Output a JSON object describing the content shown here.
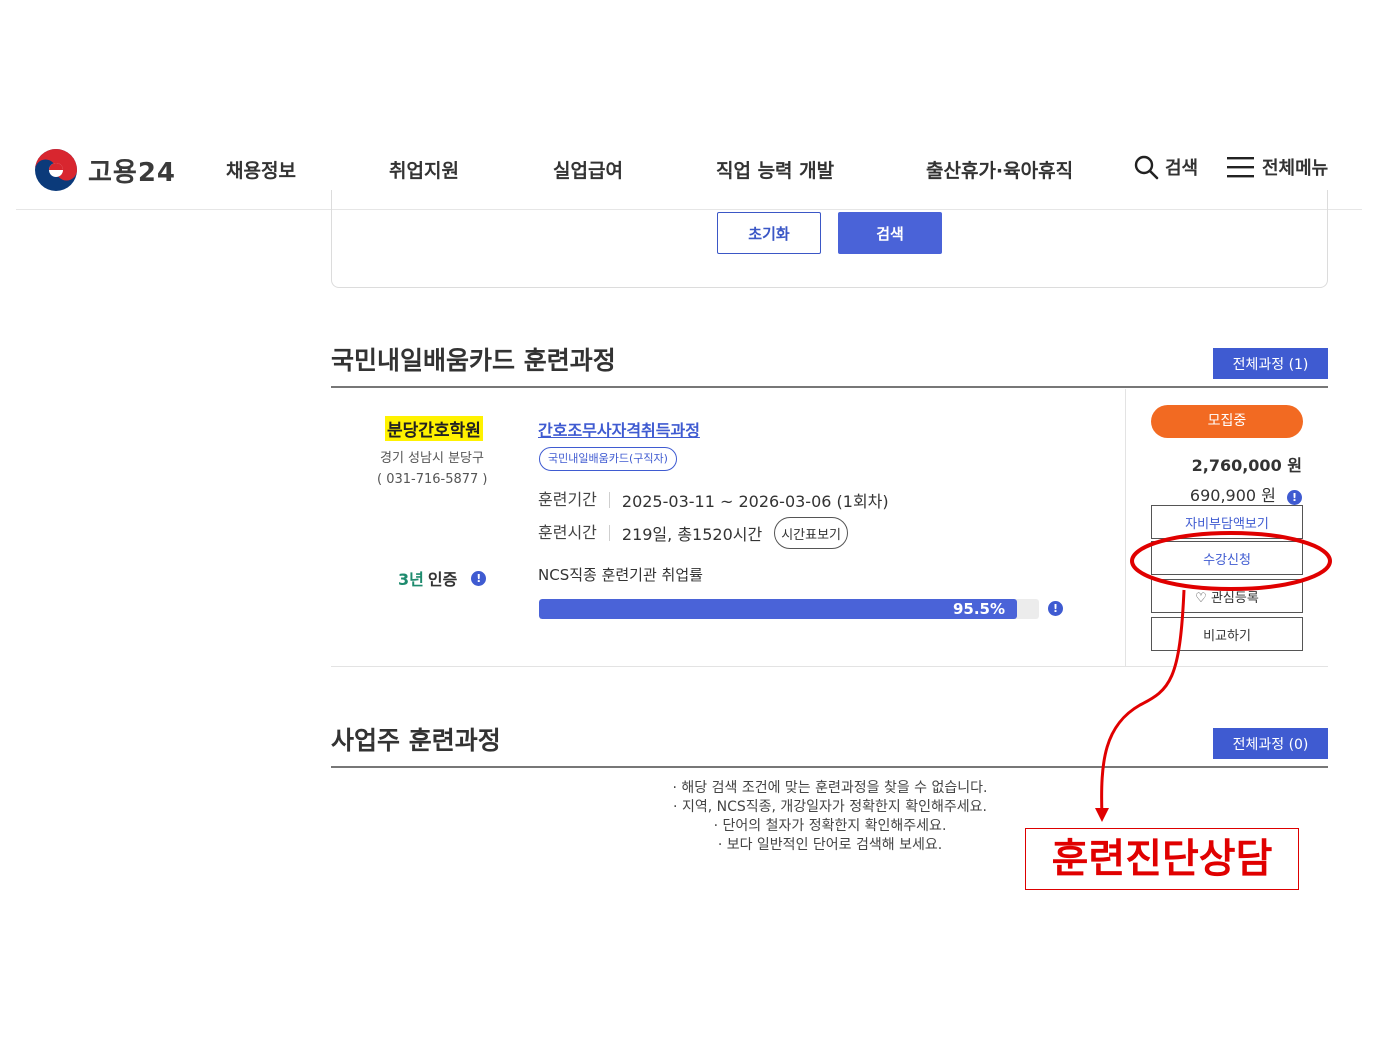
{
  "header": {
    "logo_text": "고용24",
    "nav": [
      "채용정보",
      "취업지원",
      "실업급여",
      "직업 능력 개발",
      "출산휴가·육아휴직"
    ],
    "search_label": "검색",
    "menu_label": "전체메뉴"
  },
  "search_form": {
    "reset_label": "초기화",
    "search_label": "검색"
  },
  "section_card": {
    "title": "국민내일배움카드 훈련과정",
    "all_label": "전체과정 (1)"
  },
  "course": {
    "institution": "분당간호학원",
    "address": "경기 성남시 분당구",
    "phone": "( 031-716-5877 )",
    "cert_years": "3년",
    "cert_label": "인증",
    "title": "간호조무사자격취득과정",
    "tag": "국민내일배움카드(구직자)",
    "period_label": "훈련기간",
    "period_value": "2025-03-11 ~ 2026-03-06 (1회차)",
    "hours_label": "훈련시간",
    "hours_value": "219일, 총1520시간",
    "timetable_label": "시간표보기",
    "ncs_label": "NCS직종 훈련기관 취업률",
    "employment_rate": 95.5,
    "employment_rate_text": "95.5%",
    "status": "모집중",
    "price_total": "2,760,000 원",
    "price_self": "690,900 원",
    "self_pay_label": "자비부담액보기",
    "apply_label": "수강신청",
    "fav_label": "관심등록",
    "compare_label": "비교하기"
  },
  "section_employer": {
    "title": "사업주 훈련과정",
    "all_label": "전체과정 (0)",
    "empty_messages": [
      "· 해당 검색 조건에 맞는 훈련과정을 찾을 수 없습니다.",
      "· 지역, NCS직종, 개강일자가 정확한지 확인해주세요.",
      "· 단어의 철자가 정확한지 확인해주세요.",
      "· 보다 일반적인 단어로 검색해 보세요."
    ]
  },
  "annotation": {
    "label": "훈련진단상담",
    "color": "#e00000"
  },
  "colors": {
    "primary": "#3f5bd1",
    "status": "#f26a22",
    "highlight": "#fff200"
  }
}
